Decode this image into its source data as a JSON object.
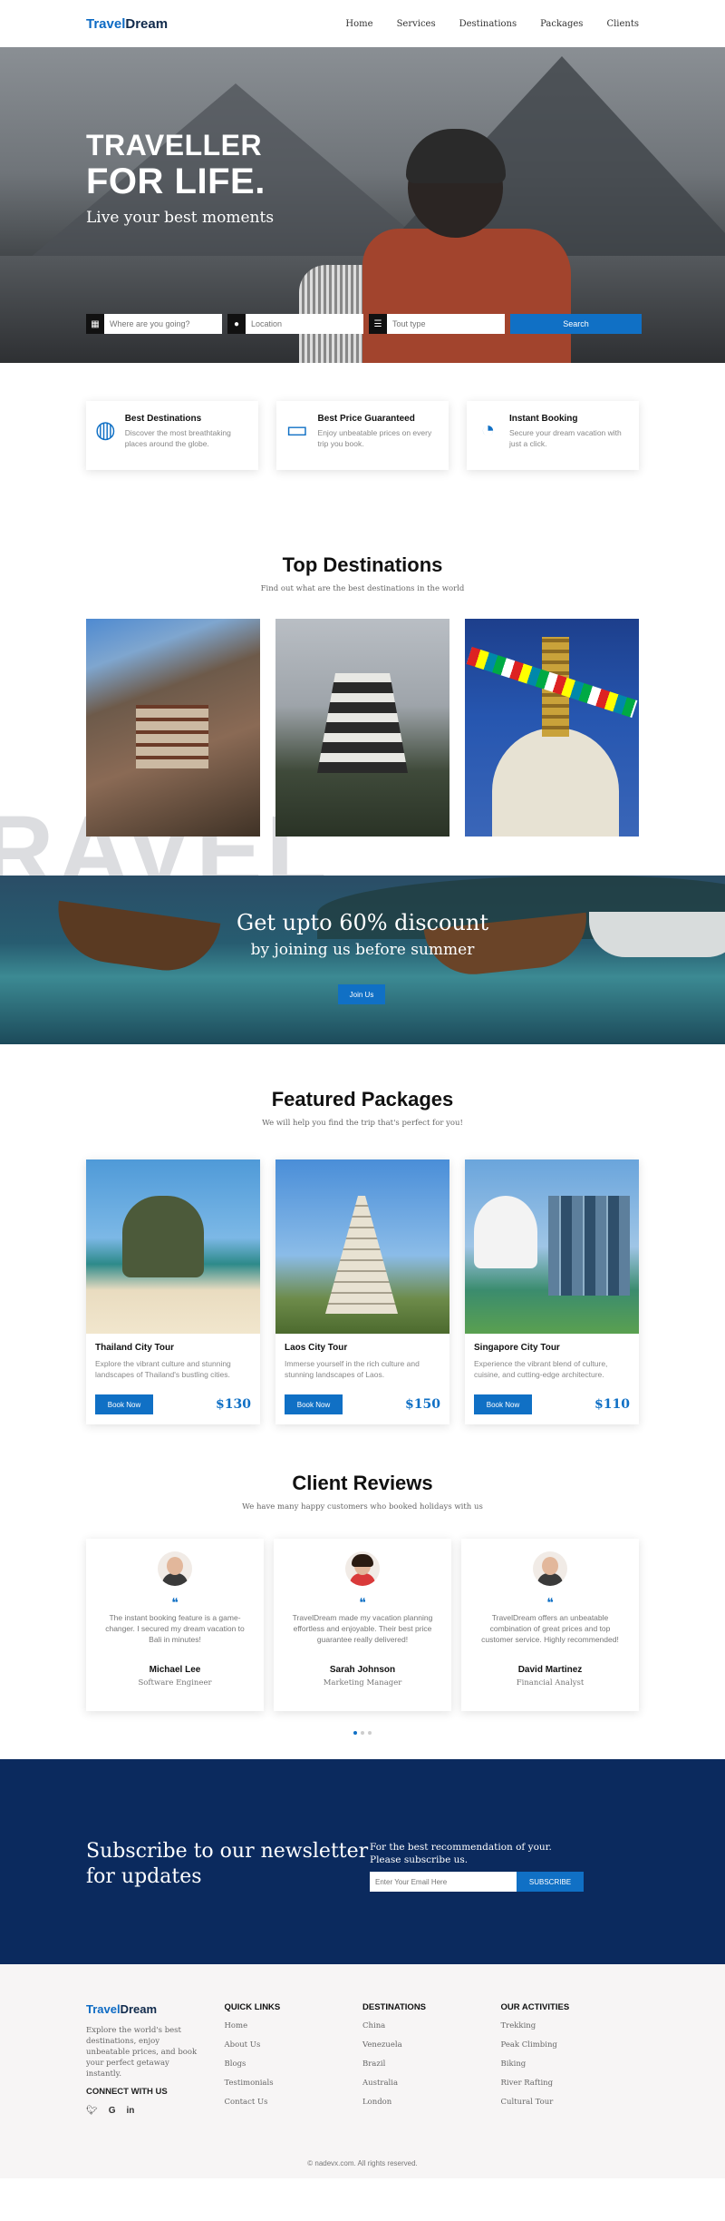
{
  "brand": {
    "part1": "Travel",
    "part2": "Dream"
  },
  "nav": {
    "items": [
      "Home",
      "Services",
      "Destinations",
      "Packages",
      "Clients"
    ]
  },
  "hero": {
    "line1": "TRAVELLER",
    "line2": "FOR LIFE.",
    "tagline": "Live your best moments",
    "search": {
      "where_placeholder": "Where are you going?",
      "location_placeholder": "Location",
      "type_placeholder": "Tout type",
      "button": "Search"
    }
  },
  "features": [
    {
      "title": "Best Destinations",
      "text": "Discover the most breathtaking places around the globe.",
      "icon": "globe-icon"
    },
    {
      "title": "Best Price Guaranteed",
      "text": "Enjoy unbeatable prices on every trip you book.",
      "icon": "money-hand-icon"
    },
    {
      "title": "Instant Booking",
      "text": "Secure your dream vacation with just a click.",
      "icon": "stopwatch-icon"
    }
  ],
  "destinations": {
    "title": "Top Destinations",
    "subtitle": "Find out what are the best destinations in the world",
    "bg_word": "RAVEL"
  },
  "banner": {
    "headline": "Get upto 60% discount",
    "sub": "by joining us before summer",
    "button": "Join Us"
  },
  "packages": {
    "title": "Featured Packages",
    "subtitle": "We will help you find the trip that's perfect for you!",
    "items": [
      {
        "name": "Thailand City Tour",
        "desc": "Explore the vibrant culture and stunning landscapes of Thailand's bustling cities.",
        "price": "$130",
        "button": "Book Now"
      },
      {
        "name": "Laos City Tour",
        "desc": "Immerse yourself in the rich culture and stunning landscapes of Laos.",
        "price": "$150",
        "button": "Book Now"
      },
      {
        "name": "Singapore City Tour",
        "desc": "Experience the vibrant blend of culture, cuisine, and cutting-edge architecture.",
        "price": "$110",
        "button": "Book Now"
      }
    ]
  },
  "reviews": {
    "title": "Client Reviews",
    "subtitle": "We have many happy customers who booked holidays with us",
    "items": [
      {
        "text": "The instant booking feature is a game-changer. I secured my dream vacation to Bali in minutes!",
        "name": "Michael Lee",
        "role": "Software Engineer"
      },
      {
        "text": "TravelDream made my vacation planning effortless and enjoyable. Their best price guarantee really delivered!",
        "name": "Sarah Johnson",
        "role": "Marketing Manager"
      },
      {
        "text": "TravelDream offers an unbeatable combination of great prices and top customer service. Highly recommended!",
        "name": "David Martinez",
        "role": "Financial Analyst"
      }
    ]
  },
  "newsletter": {
    "title_line1": "Subscribe to our newsletter",
    "title_line2": "for updates",
    "text_line1": "For the best recommendation of your.",
    "text_line2": "Please subscribe us.",
    "placeholder": "Enter Your Email Here",
    "button": "SUBSCRIBE"
  },
  "footer": {
    "about": "Explore the world's best destinations, enjoy unbeatable prices, and book your perfect getaway instantly.",
    "connect": "CONNECT WITH US",
    "socials": [
      "twitter-icon",
      "google-icon",
      "linkedin-icon"
    ],
    "quick_links": {
      "title": "QUICK LINKS",
      "items": [
        "Home",
        "About Us",
        "Blogs",
        "Testimonials",
        "Contact Us"
      ]
    },
    "destinations": {
      "title": "DESTINATIONS",
      "items": [
        "China",
        "Venezuela",
        "Brazil",
        "Australia",
        "London"
      ]
    },
    "activities": {
      "title": "OUR ACTIVITIES",
      "items": [
        "Trekking",
        "Peak Climbing",
        "Biking",
        "River Rafting",
        "Cultural Tour"
      ]
    },
    "copyright": "© nadevx.com. All rights reserved."
  },
  "colors": {
    "accent": "#1070c5",
    "navy": "#0b2a5e"
  }
}
